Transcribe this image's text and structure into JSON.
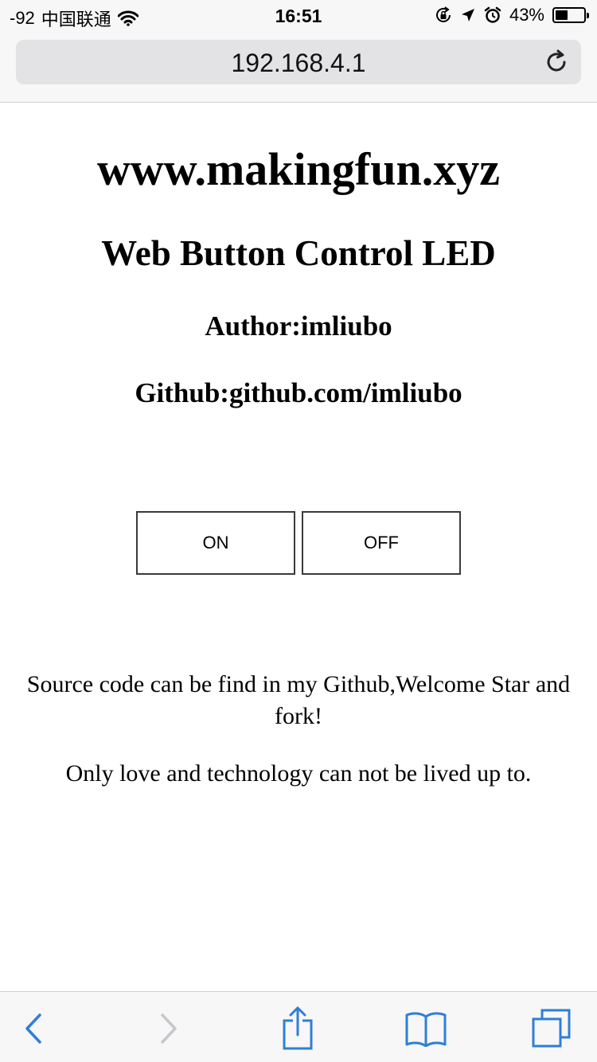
{
  "status_bar": {
    "signal": "-92",
    "carrier": "中国联通",
    "time": "16:51",
    "battery": "43%",
    "battery_level": 0.43,
    "icons": [
      "wifi-icon",
      "rotation-lock-icon",
      "location-arrow-icon",
      "alarm-icon",
      "battery-icon"
    ]
  },
  "address_bar": {
    "url": "192.168.4.1",
    "reload_icon": "reload-icon"
  },
  "page": {
    "site": "www.makingfun.xyz",
    "title": "Web Button Control LED",
    "author": "Author:imliubo",
    "github": "Github:github.com/imliubo",
    "buttons": {
      "on": "ON",
      "off": "OFF"
    },
    "source_text": "Source code can be find in my Github,Welcome Star and fork!",
    "love_text": "Only love and technology can not be lived up to."
  },
  "toolbar": {
    "items": [
      "back-icon",
      "forward-icon",
      "share-icon",
      "bookmarks-icon",
      "tabs-icon"
    ]
  },
  "colors": {
    "accent": "#2f7fd6",
    "disabled": "#c7c7cc",
    "chrome_bg": "#f7f7f7",
    "url_field": "#e3e3e5"
  }
}
